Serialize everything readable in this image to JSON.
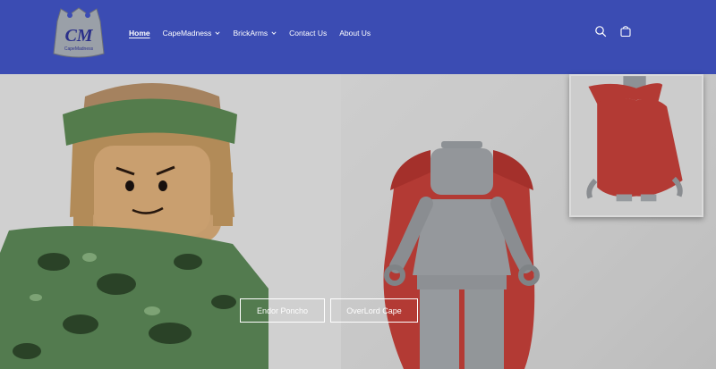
{
  "brand": {
    "logo_text": "CM",
    "logo_subtext": "CapeMadness",
    "header_bg": "#3b4cb3"
  },
  "nav": {
    "items": [
      {
        "label": "Home",
        "active": true,
        "dropdown": false
      },
      {
        "label": "CapeMadness",
        "active": false,
        "dropdown": true
      },
      {
        "label": "BrickArms",
        "active": false,
        "dropdown": true
      },
      {
        "label": "Contact Us",
        "active": false,
        "dropdown": false
      },
      {
        "label": "About Us",
        "active": false,
        "dropdown": false
      }
    ]
  },
  "header_icons": [
    "search-icon",
    "cart-icon"
  ],
  "hero": {
    "buttons": [
      {
        "label": "Endor Poncho"
      },
      {
        "label": "OverLord Cape"
      }
    ]
  }
}
